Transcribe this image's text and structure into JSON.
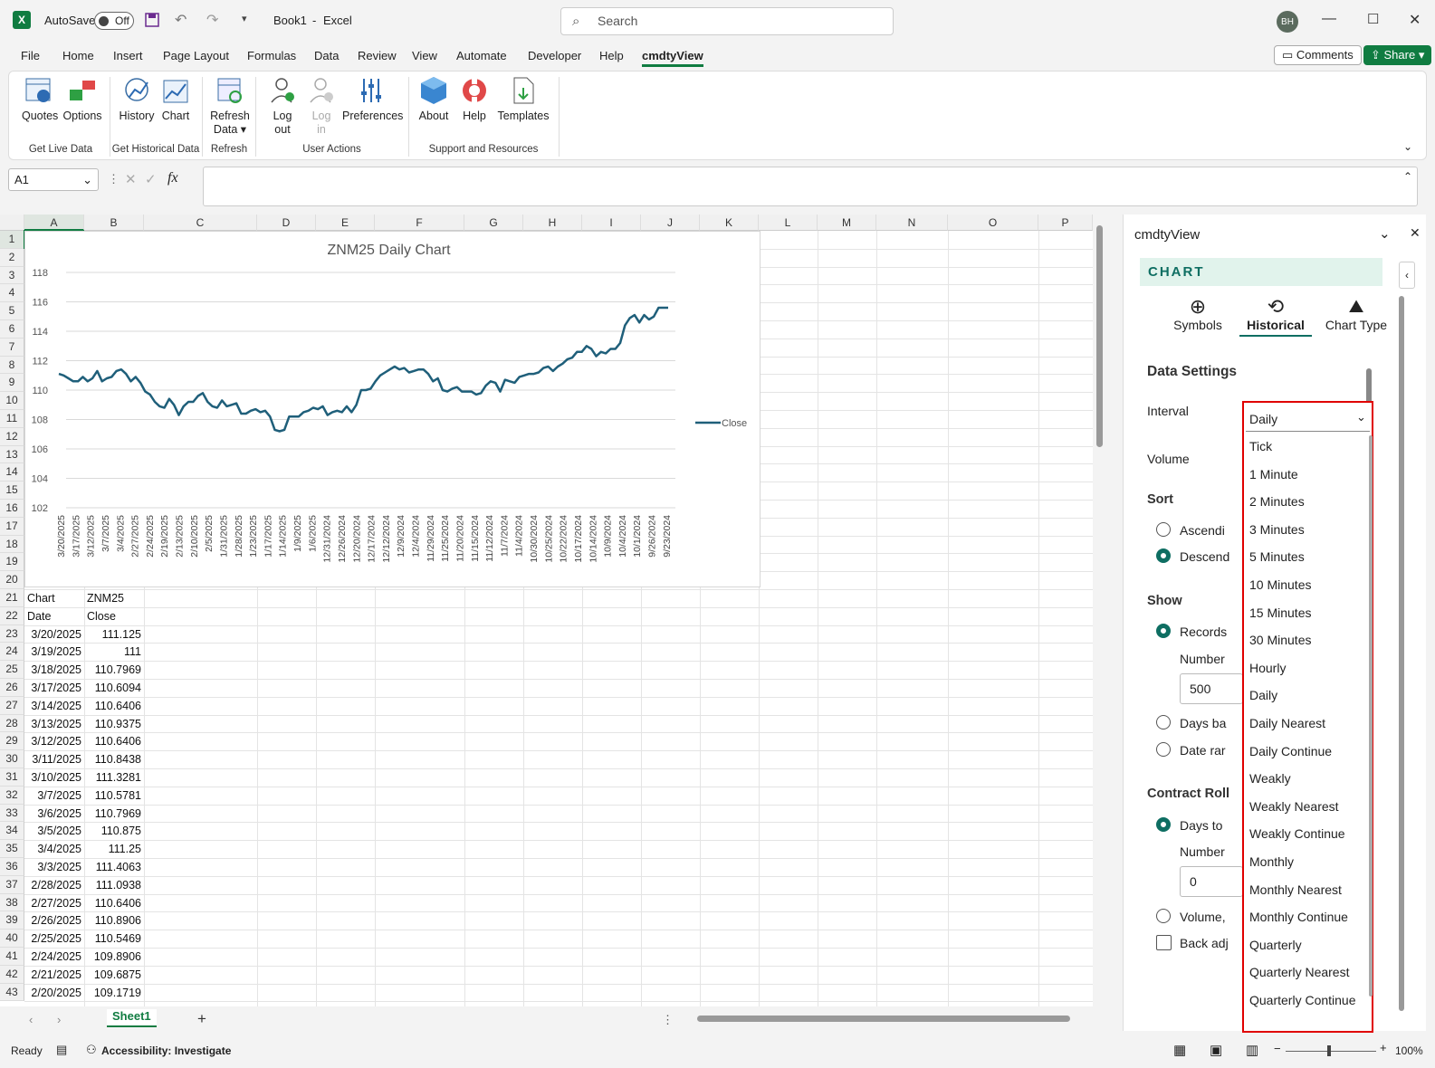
{
  "titlebar": {
    "autosave": "AutoSave",
    "toggle": "Off",
    "book": "Book1",
    "sep": "-",
    "app": "Excel",
    "search": "Search",
    "avatar": "BH"
  },
  "menu": [
    "File",
    "Home",
    "Insert",
    "Page Layout",
    "Formulas",
    "Data",
    "Review",
    "View",
    "Automate",
    "Developer",
    "Help",
    "cmdtyView"
  ],
  "menu_buttons": {
    "comments": "Comments",
    "share": "Share"
  },
  "ribbon": {
    "buttons": [
      "Quotes",
      "Options",
      "History",
      "Chart",
      "Refresh",
      "Data",
      "Log",
      "out",
      "Log",
      "in",
      "Preferences",
      "About",
      "Help",
      "Templates"
    ],
    "groups": [
      "Get Live Data",
      "Get Historical Data",
      "Refresh",
      "User Actions",
      "Support and Resources"
    ]
  },
  "formula": {
    "namebox": "A1",
    "fx": "fx"
  },
  "grid": {
    "columns": [
      "A",
      "B",
      "C",
      "D",
      "E",
      "F",
      "G",
      "H",
      "I",
      "J",
      "K",
      "L",
      "M",
      "N",
      "O",
      "P"
    ],
    "rows": [
      "1",
      "2",
      "3",
      "4",
      "5",
      "6",
      "7",
      "8",
      "9",
      "10",
      "11",
      "12",
      "13",
      "14",
      "15",
      "16",
      "17",
      "18",
      "19",
      "20",
      "21",
      "22",
      "23",
      "24",
      "25",
      "26",
      "27",
      "28",
      "29",
      "30",
      "31",
      "32",
      "33",
      "34",
      "35",
      "36",
      "37",
      "38",
      "39",
      "40",
      "41",
      "42",
      "43"
    ],
    "r21": [
      "Chart",
      "ZNM25"
    ],
    "r22": [
      "Date",
      "Close"
    ],
    "dates": [
      "3/20/2025",
      "3/19/2025",
      "3/18/2025",
      "3/17/2025",
      "3/14/2025",
      "3/13/2025",
      "3/12/2025",
      "3/11/2025",
      "3/10/2025",
      "3/7/2025",
      "3/6/2025",
      "3/5/2025",
      "3/4/2025",
      "3/3/2025",
      "2/28/2025",
      "2/27/2025",
      "2/26/2025",
      "2/25/2025",
      "2/24/2025",
      "2/21/2025",
      "2/20/2025"
    ],
    "closes": [
      "111.125",
      "111",
      "110.7969",
      "110.6094",
      "110.6406",
      "110.9375",
      "110.6406",
      "110.8438",
      "111.3281",
      "110.5781",
      "110.7969",
      "110.875",
      "111.25",
      "111.4063",
      "111.0938",
      "110.6406",
      "110.8906",
      "110.5469",
      "109.8906",
      "109.6875",
      "109.1719"
    ]
  },
  "chart_data": {
    "type": "line",
    "title": "ZNM25 Daily Chart",
    "ylim": [
      102,
      118
    ],
    "yticks": [
      "102",
      "104",
      "106",
      "108",
      "110",
      "112",
      "114",
      "116",
      "118"
    ],
    "xticks": [
      "3/20/2025",
      "3/17/2025",
      "3/12/2025",
      "3/7/2025",
      "3/4/2025",
      "2/27/2025",
      "2/24/2025",
      "2/19/2025",
      "2/13/2025",
      "2/10/2025",
      "2/5/2025",
      "1/31/2025",
      "1/28/2025",
      "1/23/2025",
      "1/17/2025",
      "1/14/2025",
      "1/9/2025",
      "1/6/2025",
      "12/31/2024",
      "12/26/2024",
      "12/20/2024",
      "12/17/2024",
      "12/12/2024",
      "12/9/2024",
      "12/4/2024",
      "11/29/2024",
      "11/25/2024",
      "11/20/2024",
      "11/15/2024",
      "11/12/2024",
      "11/7/2024",
      "11/4/2024",
      "10/30/2024",
      "10/25/2024",
      "10/22/2024",
      "10/17/2024",
      "10/14/2024",
      "10/9/2024",
      "10/4/2024",
      "10/1/2024",
      "9/26/2024",
      "9/23/2024"
    ],
    "series": [
      {
        "name": "Close",
        "color": "#1f5f7a",
        "values": [
          111.1,
          111.0,
          110.8,
          110.6,
          110.6,
          110.9,
          110.6,
          110.8,
          111.3,
          110.6,
          110.8,
          110.9,
          111.3,
          111.4,
          111.1,
          110.6,
          110.9,
          110.5,
          109.9,
          109.7,
          109.2,
          108.9,
          108.8,
          109.4,
          109.0,
          108.3,
          108.9,
          109.2,
          109.2,
          109.6,
          109.8,
          109.2,
          108.9,
          108.8,
          109.3,
          108.9,
          109.0,
          109.1,
          108.4,
          108.4,
          108.6,
          108.7,
          108.5,
          108.6,
          108.2,
          107.3,
          107.2,
          107.3,
          108.2,
          108.2,
          108.2,
          108.5,
          108.6,
          108.8,
          108.7,
          108.9,
          108.3,
          108.5,
          108.6,
          108.5,
          108.9,
          108.5,
          109.0,
          110.0,
          110.0,
          110.1,
          110.6,
          111.0,
          111.2,
          111.4,
          111.6,
          111.4,
          111.5,
          111.2,
          111.3,
          111.4,
          111.4,
          111.1,
          110.6,
          110.8,
          110.0,
          109.9,
          110.1,
          110.2,
          109.9,
          109.9,
          109.9,
          109.7,
          109.8,
          110.3,
          110.6,
          110.5,
          109.9,
          110.7,
          110.6,
          110.5,
          110.9,
          111.0,
          111.1,
          111.1,
          111.2,
          111.5,
          111.6,
          111.3,
          111.6,
          111.8,
          112.1,
          112.2,
          112.6,
          112.6,
          113.0,
          112.8,
          112.3,
          112.6,
          112.5,
          112.8,
          112.8,
          113.2,
          114.4,
          114.9,
          115.1,
          114.6,
          115.1,
          114.8,
          115.0,
          115.6,
          115.6,
          115.6
        ]
      }
    ]
  },
  "sheets": {
    "active": "Sheet1",
    "add": "+"
  },
  "status": {
    "ready": "Ready",
    "accessibility": "Accessibility: Investigate",
    "zoom": "100%"
  },
  "pane": {
    "title": "cmdtyView",
    "section": "CHART",
    "tabs": [
      "Symbols",
      "Historical",
      "Chart Type"
    ],
    "data_settings": "Data Settings",
    "interval_label": "Interval",
    "interval_value": "Daily",
    "volume_label": "Volume",
    "sort_label": "Sort",
    "sort_options": [
      "Ascendi",
      "Descend"
    ],
    "show_label": "Show",
    "show_options": [
      "Records",
      "Days ba",
      "Date rar"
    ],
    "number_label": "Number",
    "number_value": "500",
    "contract_roll": "Contract Roll",
    "roll_options": [
      "Days to",
      "Volume,"
    ],
    "roll_number_label": "Number",
    "roll_number_value": "0",
    "back_adj": "Back adj"
  },
  "dropdown": [
    "Tick",
    "1 Minute",
    "2 Minutes",
    "3 Minutes",
    "5 Minutes",
    "10 Minutes",
    "15 Minutes",
    "30 Minutes",
    "Hourly",
    "Daily",
    "Daily Nearest",
    "Daily Continue",
    "Weakly",
    "Weakly Nearest",
    "Weakly Continue",
    "Monthly",
    "Monthly Nearest",
    "Monthly Continue",
    "Quarterly",
    "Quarterly Nearest",
    "Quarterly Continue"
  ]
}
